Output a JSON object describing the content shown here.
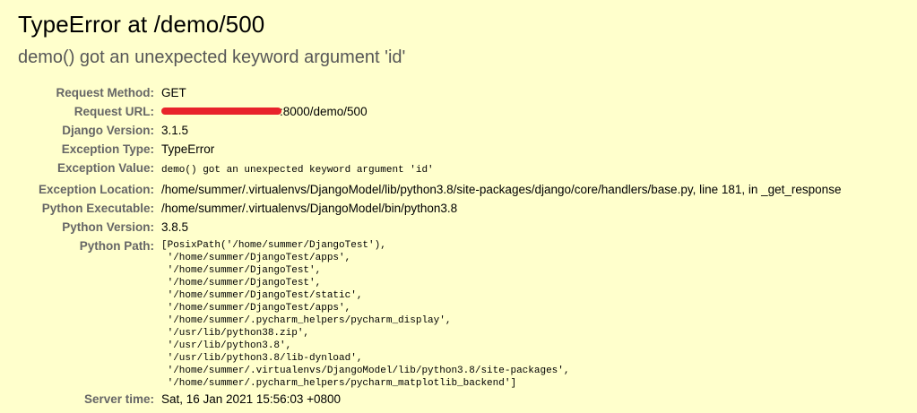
{
  "error": {
    "title": "TypeError at /demo/500",
    "message": "demo() got an unexpected keyword argument 'id'"
  },
  "meta": {
    "request_method": {
      "label": "Request Method:",
      "value": "GET"
    },
    "request_url": {
      "label": "Request URL:",
      "value": ":8000/demo/500"
    },
    "django_version": {
      "label": "Django Version:",
      "value": "3.1.5"
    },
    "exception_type": {
      "label": "Exception Type:",
      "value": "TypeError"
    },
    "exception_value": {
      "label": "Exception Value:",
      "value": "demo() got an unexpected keyword argument 'id'"
    },
    "exception_location": {
      "label": "Exception Location:",
      "value": "/home/summer/.virtualenvs/DjangoModel/lib/python3.8/site-packages/django/core/handlers/base.py, line 181, in _get_response"
    },
    "python_executable": {
      "label": "Python Executable:",
      "value": "/home/summer/.virtualenvs/DjangoModel/bin/python3.8"
    },
    "python_version": {
      "label": "Python Version:",
      "value": "3.8.5"
    },
    "python_path": {
      "label": "Python Path:",
      "value": "[PosixPath('/home/summer/DjangoTest'),\n '/home/summer/DjangoTest/apps',\n '/home/summer/DjangoTest',\n '/home/summer/DjangoTest',\n '/home/summer/DjangoTest/static',\n '/home/summer/DjangoTest/apps',\n '/home/summer/.pycharm_helpers/pycharm_display',\n '/usr/lib/python38.zip',\n '/usr/lib/python3.8',\n '/usr/lib/python3.8/lib-dynload',\n '/home/summer/.virtualenvs/DjangoModel/lib/python3.8/site-packages',\n '/home/summer/.pycharm_helpers/pycharm_matplotlib_backend']"
    },
    "server_time": {
      "label": "Server time:",
      "value": "Sat, 16 Jan 2021 15:56:03 +0800"
    }
  },
  "colors": {
    "background": "#ffffcc",
    "label": "#666666",
    "subtitle": "#575757",
    "redaction": "#e8232b"
  }
}
